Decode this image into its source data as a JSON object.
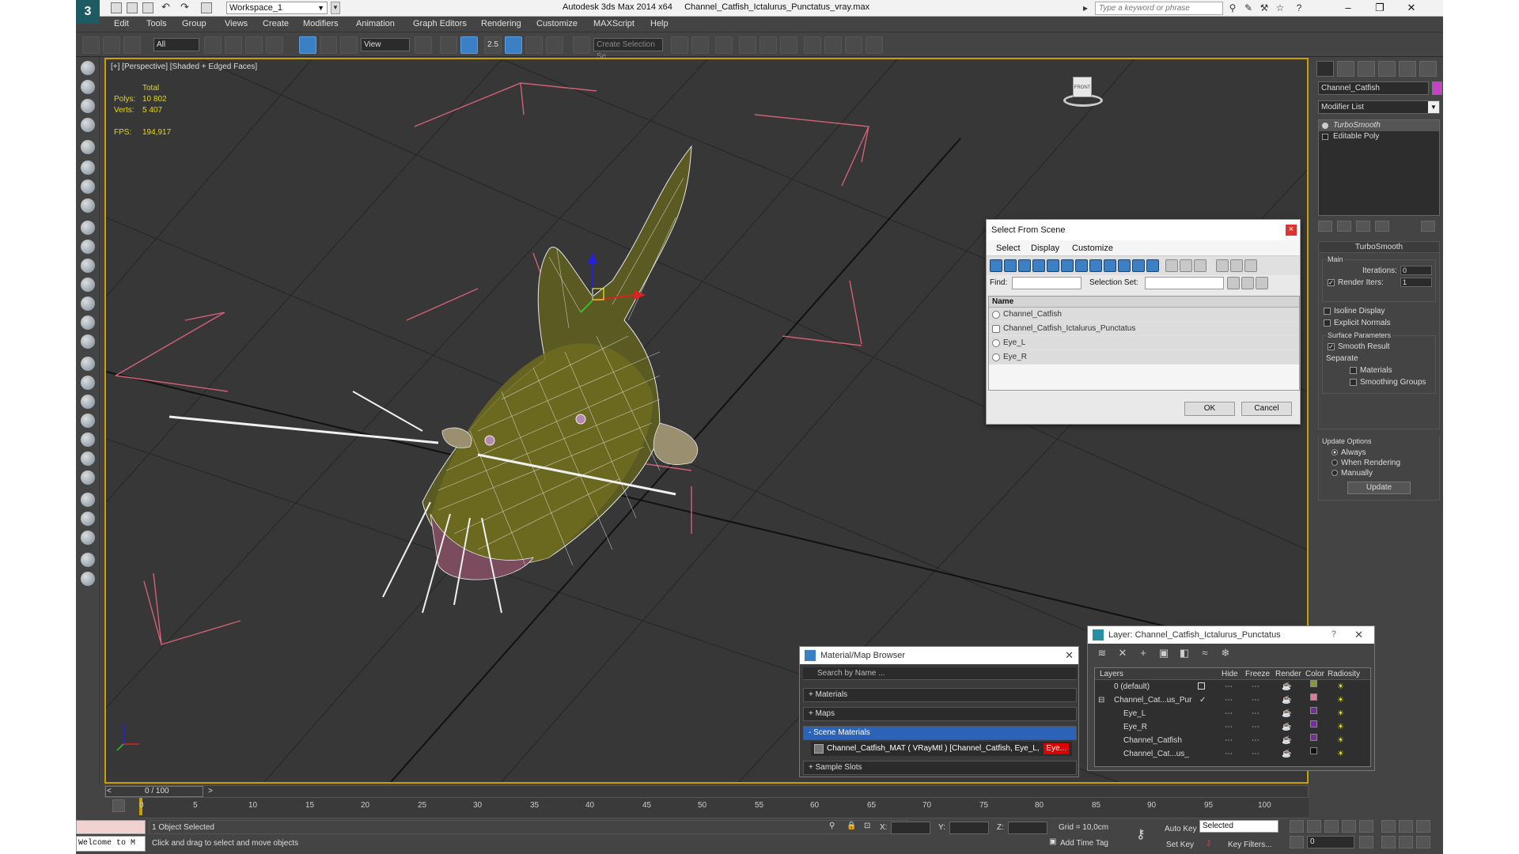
{
  "app": {
    "title": "Autodesk 3ds Max  2014 x64",
    "file": "Channel_Catfish_Ictalurus_Punctatus_vray.max",
    "workspace": "Workspace_1",
    "search_placeholder": "Type a keyword or phrase",
    "logo": "3"
  },
  "menu": [
    "Edit",
    "Tools",
    "Group",
    "Views",
    "Create",
    "Modifiers",
    "Animation",
    "Graph Editors",
    "Rendering",
    "Customize",
    "MAXScript",
    "Help"
  ],
  "toolbar": {
    "filter_value": "All",
    "refcoord_value": "View",
    "snap_label": "2.5",
    "named_selection_placeholder": "Create Selection Se"
  },
  "viewport": {
    "label": "[+] [Perspective] [Shaded + Edged Faces]",
    "stats": {
      "header": "Total",
      "polys_label": "Polys:",
      "polys": "10 802",
      "verts_label": "Verts:",
      "verts": "5 407",
      "fps_label": "FPS:",
      "fps": "194,917"
    },
    "viewcube_label": "FRONT"
  },
  "command_panel": {
    "object_name": "Channel_Catfish",
    "object_color": "#c640c8",
    "modifier_list": "Modifier List",
    "stack": [
      "TurboSmooth",
      "Editable Poly"
    ],
    "turbosmooth": {
      "title": "TurboSmooth",
      "main_label": "Main",
      "iterations_label": "Iterations:",
      "iterations": "0",
      "render_iters_label": "Render Iters:",
      "render_iters": "1",
      "isoline": "Isoline Display",
      "explicit_normals": "Explicit Normals",
      "surface_label": "Surface Parameters",
      "smooth_result": "Smooth Result",
      "separate_label": "Separate",
      "materials": "Materials",
      "smoothing_groups": "Smoothing Groups",
      "update_label": "Update Options",
      "always": "Always",
      "when_rendering": "When Rendering",
      "manually": "Manually",
      "update_button": "Update"
    }
  },
  "select_from_scene": {
    "title": "Select From Scene",
    "close": "×",
    "menu": [
      "Select",
      "Display",
      "Customize"
    ],
    "find_label": "Find:",
    "selection_set_label": "Selection Set:",
    "column_name": "Name",
    "items": [
      "Channel_Catfish",
      "Channel_Catfish_Ictalurus_Punctatus",
      "Eye_L",
      "Eye_R"
    ],
    "ok": "OK",
    "cancel": "Cancel"
  },
  "material_browser": {
    "title": "Material/Map Browser",
    "close": "✕",
    "search_placeholder": "Search by Name ...",
    "sections": [
      "+ Materials",
      "+ Maps",
      "- Scene Materials",
      "+ Sample Slots"
    ],
    "scene_material": "Channel_Catfish_MAT  ( VRayMtl )  [Channel_Catfish, Eye_L, ",
    "scene_material_highlight": "Eye..."
  },
  "layer_explorer": {
    "title": "Layer: Channel_Catfish_Ictalurus_Punctatus",
    "help": "?",
    "close": "✕",
    "columns": [
      "Layers",
      "Hide",
      "Freeze",
      "Render",
      "Color",
      "Radiosity"
    ],
    "rows": [
      {
        "name": "0 (default)",
        "color": "#8a9a2a"
      },
      {
        "name": "Channel_Cat...us_Pur",
        "color": "#e07a9a"
      },
      {
        "name": "Eye_L",
        "color": "#7a2aa0"
      },
      {
        "name": "Eye_R",
        "color": "#7a2aa0"
      },
      {
        "name": "Channel_Catfish",
        "color": "#7a2aa0"
      },
      {
        "name": "Channel_Cat...us_",
        "color": "#111111"
      }
    ]
  },
  "status": {
    "time": "0 / 100",
    "ticks": [
      "0",
      "5",
      "10",
      "15",
      "20",
      "25",
      "30",
      "35",
      "40",
      "45",
      "50",
      "55",
      "60",
      "65",
      "70",
      "75",
      "80",
      "85",
      "90",
      "95",
      "100"
    ],
    "selected": "1 Object Selected",
    "prompt": "Click and drag to select and move objects",
    "maxscript": "Welcome to M",
    "x_label": "X:",
    "y_label": "Y:",
    "z_label": "Z:",
    "grid": "Grid = 10,0cm",
    "add_time_tag": "Add Time Tag",
    "auto_key": "Auto Key",
    "selected_dropdown": "Selected",
    "set_key": "Set Key",
    "key_filters": "Key Filters...",
    "frame": "0"
  }
}
